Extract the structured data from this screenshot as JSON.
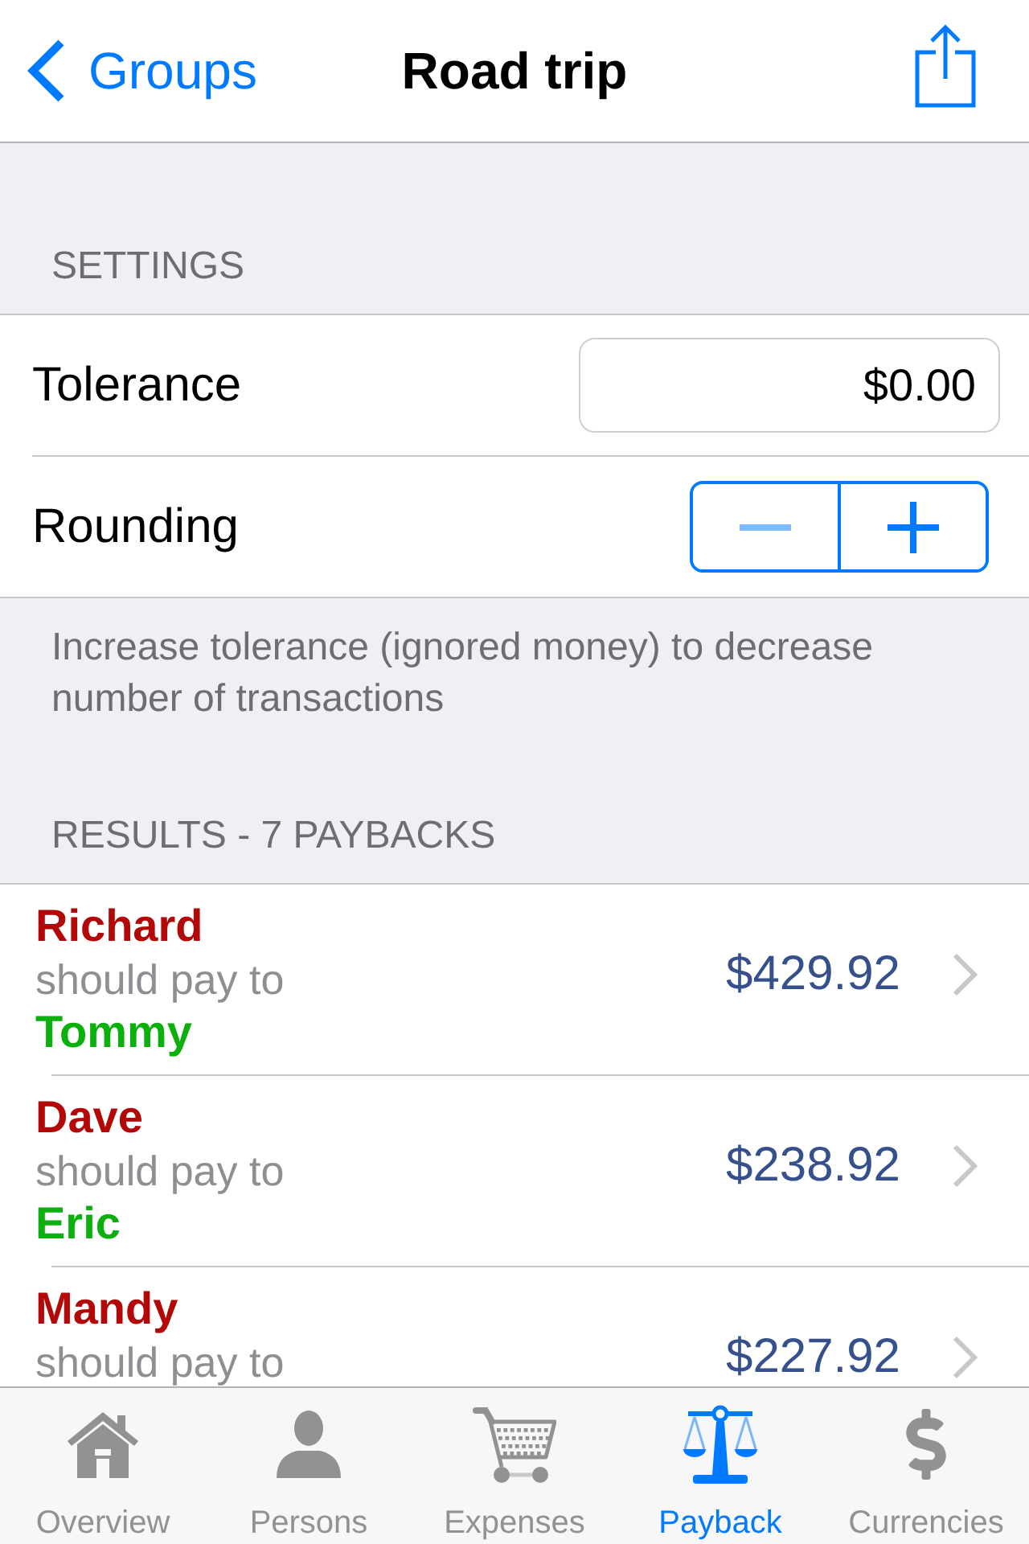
{
  "nav": {
    "back": "Groups",
    "title": "Road trip"
  },
  "settings": {
    "header": "SETTINGS",
    "tolerance": {
      "label": "Tolerance",
      "value": "$0.00"
    },
    "rounding": {
      "label": "Rounding",
      "buttons": [
        {
          "kind": "minus",
          "disabled": true
        },
        {
          "kind": "plus",
          "disabled": false
        }
      ]
    },
    "footer": "Increase tolerance (ignored money) to decrease number of transactions"
  },
  "results": {
    "header": "RESULTS - 7 PAYBACKS",
    "rows": [
      {
        "payer": "Richard",
        "relation": "should pay to",
        "payee": "Tommy",
        "amount": "$429.92"
      },
      {
        "payer": "Dave",
        "relation": "should pay to",
        "payee": "Eric",
        "amount": "$238.92"
      },
      {
        "payer": "Mandy",
        "relation": "should pay to",
        "amount": "$227.92"
      }
    ]
  },
  "tab_bar": [
    {
      "label": "Overview",
      "selected": false
    },
    {
      "label": "Persons",
      "selected": false
    },
    {
      "label": "Expenses",
      "selected": false
    },
    {
      "label": "Payback",
      "selected": true
    },
    {
      "label": "Currencies",
      "selected": false
    }
  ]
}
